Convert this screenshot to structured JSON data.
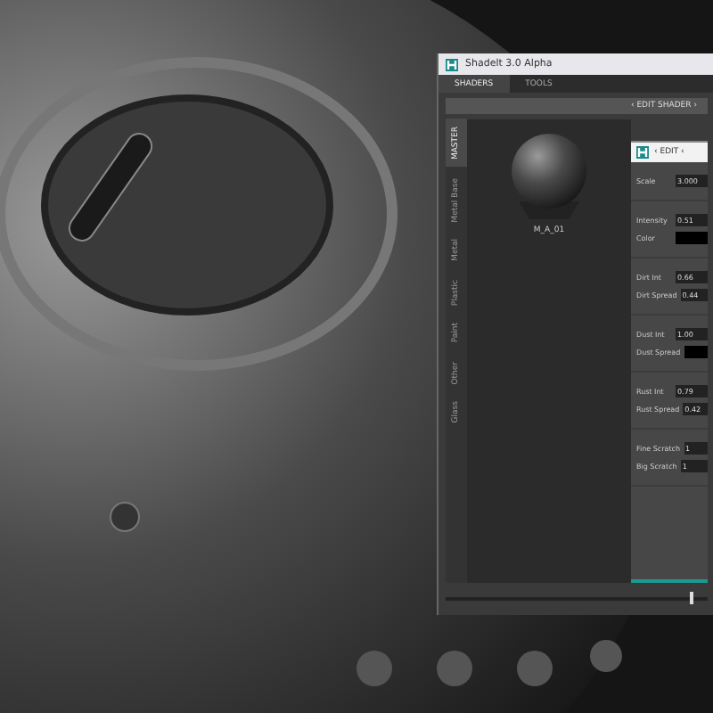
{
  "window": {
    "title": "Shadelt 3.0 Alpha"
  },
  "tabs": [
    {
      "label": "SHADERS",
      "selected": true
    },
    {
      "label": "TOOLS",
      "selected": false
    }
  ],
  "edit_bar": {
    "label": "‹ EDIT SHADER ›"
  },
  "side_tabs": [
    {
      "label": "MASTER",
      "selected": true
    },
    {
      "label": "Metal Base",
      "selected": false
    },
    {
      "label": "Metal",
      "selected": false
    },
    {
      "label": "Plastic",
      "selected": false
    },
    {
      "label": "Paint",
      "selected": false
    },
    {
      "label": "Other",
      "selected": false
    },
    {
      "label": "Glass",
      "selected": false
    }
  ],
  "preview": {
    "name": "M_A_01"
  },
  "edit_panel": {
    "title": "‹ EDIT ‹",
    "groups": [
      [
        {
          "label": "Scale",
          "kind": "value",
          "value": "3.000"
        }
      ],
      [
        {
          "label": "Intensity",
          "kind": "value",
          "value": "0.51"
        },
        {
          "label": "Color",
          "kind": "swatch",
          "color": "#000000"
        }
      ],
      [
        {
          "label": "Dirt Int",
          "kind": "value",
          "value": "0.66"
        },
        {
          "label": "Dirt Spread",
          "kind": "value",
          "value": "0.44"
        }
      ],
      [
        {
          "label": "Dust Int",
          "kind": "value",
          "value": "1.00"
        },
        {
          "label": "Dust Spread",
          "kind": "swatch",
          "color": "#000000"
        }
      ],
      [
        {
          "label": "Rust Int",
          "kind": "value",
          "value": "0.79"
        },
        {
          "label": "Rust Spread",
          "kind": "value",
          "value": "0.42"
        }
      ],
      [
        {
          "label": "Fine Scratch",
          "kind": "value",
          "value": "1"
        },
        {
          "label": "Big Scratch",
          "kind": "value",
          "value": "1"
        }
      ]
    ]
  },
  "slider": {
    "level": 0.93
  }
}
